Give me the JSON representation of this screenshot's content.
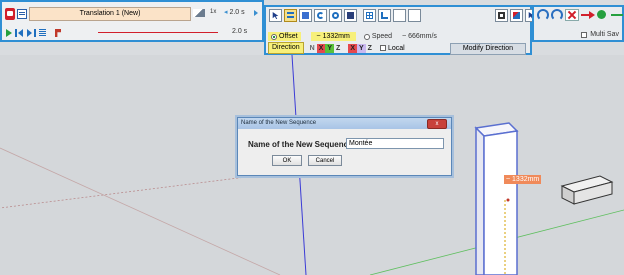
{
  "animation_toolbar": {
    "sequence_name": "Translation 1 (New)",
    "speed_multiplier": "1x",
    "duration_select": "2.0 s",
    "current_time": "2.0 s"
  },
  "motion_toolbar": {
    "offset_label": "Offset",
    "offset_value": "~ 1332mm",
    "speed_label": "Speed",
    "speed_value": "~ 666mm/s",
    "direction_label": "Direction",
    "axes": [
      "N",
      "X",
      "Y",
      "Z",
      "X",
      "Y",
      "Z"
    ],
    "local_label": "Local",
    "modify_direction_label": "Modify Direction"
  },
  "right_toolbar": {
    "multi_save_label": "Multi Sav"
  },
  "dialog": {
    "title": "Name of the New Sequence",
    "field_label": "Name of the New Sequence",
    "input_value": "Montée",
    "ok_label": "OK",
    "cancel_label": "Cancel",
    "close_label": "x"
  },
  "viewport": {
    "distance_tag": "~ 1332mm"
  }
}
